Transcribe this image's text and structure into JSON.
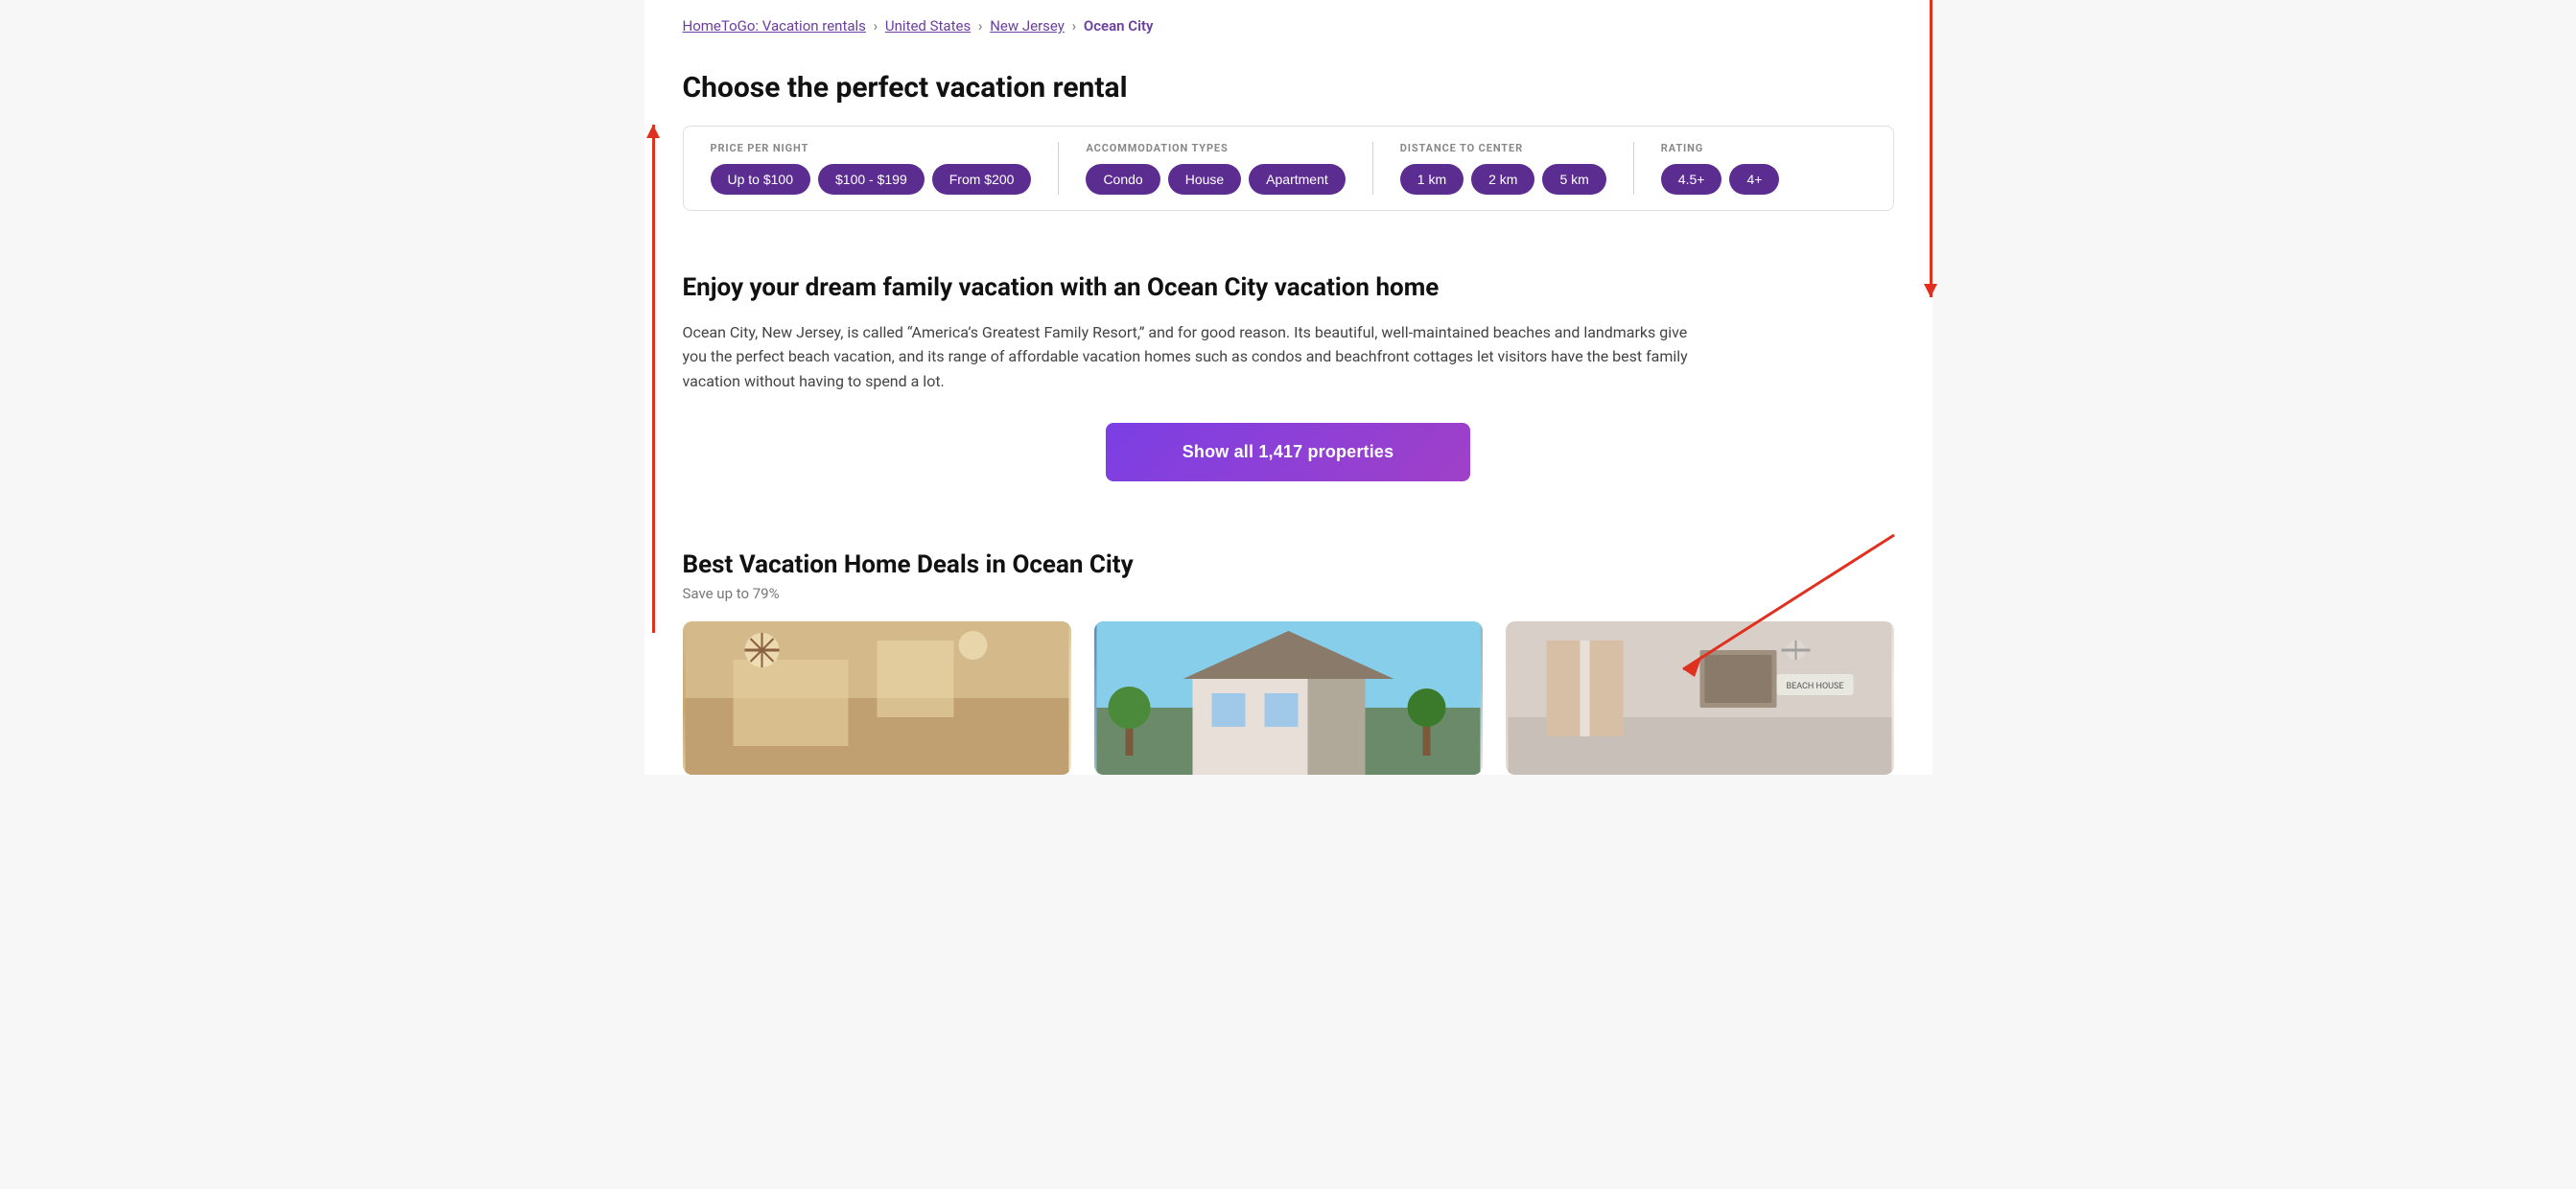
{
  "breadcrumb": {
    "items": [
      {
        "label": "HomeToGo: Vacation rentals",
        "url": true
      },
      {
        "label": "United States",
        "url": true
      },
      {
        "label": "New Jersey",
        "url": true
      },
      {
        "label": "Ocean City",
        "url": false,
        "active": true
      }
    ],
    "separator": "›"
  },
  "choose_section": {
    "title": "Choose the perfect vacation rental"
  },
  "filters": {
    "price_label": "PRICE PER NIGHT",
    "price_pills": [
      {
        "label": "Up to $100"
      },
      {
        "label": "$100 - $199"
      },
      {
        "label": "From $200"
      }
    ],
    "accommodation_label": "ACCOMMODATION TYPES",
    "accommodation_pills": [
      {
        "label": "Condo"
      },
      {
        "label": "House"
      },
      {
        "label": "Apartment"
      }
    ],
    "distance_label": "DISTANCE TO CENTER",
    "distance_pills": [
      {
        "label": "1 km"
      },
      {
        "label": "2 km"
      },
      {
        "label": "5 km"
      }
    ],
    "rating_label": "RATING",
    "rating_pills": [
      {
        "label": "4.5+"
      },
      {
        "label": "4+"
      }
    ]
  },
  "dream_section": {
    "title": "Enjoy your dream family vacation with an Ocean City vacation home",
    "body": "Ocean City, New Jersey, is called “America’s Greatest Family Resort,” and for good reason. Its beautiful, well-maintained beaches and landmarks give you the perfect beach vacation, and its range of affordable vacation homes such as condos and beachfront cottages let visitors have the best family vacation without having to spend a lot."
  },
  "show_all_button": {
    "label": "Show all 1,417 properties"
  },
  "deals_section": {
    "title": "Best Vacation Home Deals in Ocean City",
    "subtitle": "Save up to 79%",
    "cards": [
      {
        "id": 1,
        "type": "interior"
      },
      {
        "id": 2,
        "type": "exterior"
      },
      {
        "id": 3,
        "type": "bedroom"
      }
    ]
  }
}
